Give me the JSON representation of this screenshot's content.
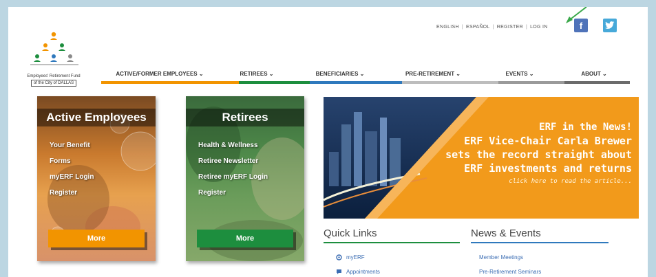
{
  "colors": {
    "orange": "#f29400",
    "green": "#1d8e3e",
    "blue": "#2f79bd",
    "gray": "#a5a5a5",
    "dark_gray": "#6b6b6b",
    "link_blue": "#3b6db3"
  },
  "header": {
    "util_links": [
      "ENGLISH",
      "ESPAÑOL",
      "REGISTER",
      "LOG IN"
    ],
    "social": [
      {
        "name": "facebook-icon",
        "glyph": "f"
      },
      {
        "name": "twitter-icon",
        "glyph": "t"
      }
    ],
    "logo": {
      "line1": "Employees' Retirement Fund",
      "line2": "of the City of DALLAS"
    }
  },
  "nav": {
    "items": [
      {
        "label": "ACTIVE/FORMER EMPLOYEES ⌄",
        "color": "#f29400"
      },
      {
        "label": "RETIREES ⌄",
        "color": "#1d8e3e"
      },
      {
        "label": "BENEFICIARIES ⌄",
        "color": "#2f79bd"
      },
      {
        "label": "PRE-RETIREMENT ⌄",
        "color": "#bdbdbd"
      },
      {
        "label": "EVENTS ⌄",
        "color": "#9a9a9a"
      },
      {
        "label": "ABOUT ⌄",
        "color": "#6b6b6b"
      }
    ]
  },
  "panels": {
    "active": {
      "title": "Active Employees",
      "links": [
        "Your Benefit",
        "Forms",
        "myERF Login",
        "Register"
      ],
      "more": "More"
    },
    "retirees": {
      "title": "Retirees",
      "links": [
        "Health & Wellness",
        "Retiree Newsletter",
        "Retiree myERF Login",
        "Register"
      ],
      "more": "More"
    }
  },
  "banner": {
    "line1": "ERF in the News!",
    "line2": "ERF Vice-Chair Carla Brewer",
    "line3": "sets the record straight about",
    "line4": "ERF investments and returns",
    "cta": "click here to read the article..."
  },
  "quick_links": {
    "title": "Quick Links",
    "items": [
      {
        "label": "myERF",
        "icon": "circle-icon"
      },
      {
        "label": "Appointments",
        "icon": "speech-bubble-icon"
      }
    ]
  },
  "news": {
    "title": "News & Events",
    "items": [
      "Member Meetings",
      "Pre-Retirement Seminars"
    ]
  }
}
